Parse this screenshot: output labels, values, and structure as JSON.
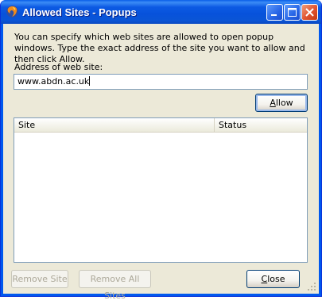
{
  "window": {
    "title": "Allowed Sites - Popups"
  },
  "dialog": {
    "description": "You can specify which web sites are allowed to open popup windows. Type the exact address of the site you want to allow and then click Allow.",
    "address_label": "Address of web site:",
    "address_value": "www.abdn.ac.uk",
    "allow_label": "Allow",
    "allow_accesskey": "A",
    "allow_rest": "llow"
  },
  "list": {
    "columns": [
      "Site",
      "Status"
    ],
    "rows": []
  },
  "buttons": {
    "remove_site": "Remove Site",
    "remove_all_sites": "Remove All Sites",
    "close": "Close",
    "close_accesskey": "C",
    "close_rest": "lose"
  }
}
